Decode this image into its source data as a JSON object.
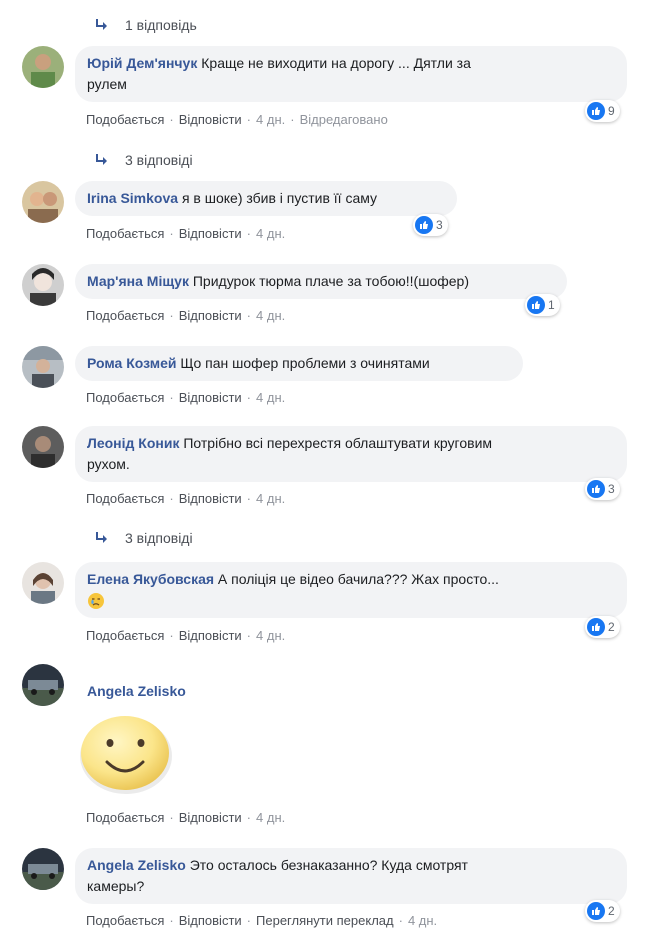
{
  "reply_links": [
    {
      "label": "1 відповідь"
    },
    {
      "label": "3 відповіді"
    },
    {
      "label": "3 відповіді"
    }
  ],
  "actions": {
    "like": "Подобається",
    "reply": "Відповісти",
    "edited": "Відредаговано",
    "translate": "Переглянути переклад"
  },
  "comments": [
    {
      "author": "Юрій Дем'янчук",
      "text": "Краще не виходити на дорогу ... Дятли за",
      "text2": "рулем",
      "time": "4 дн.",
      "reactions": "9"
    },
    {
      "author": "Irina Simkova",
      "text": "я в шоке) збив і пустив її саму",
      "time": "4 дн.",
      "reactions": "3"
    },
    {
      "author": "Мар'яна Міщук",
      "text": "Придурок тюрма плаче за тобою!!(шофер)",
      "time": "4 дн.",
      "reactions": "1"
    },
    {
      "author": "Рома Козмей",
      "text": "Що пан шофер проблеми з очинятами",
      "time": "4 дн."
    },
    {
      "author": "Леонід Коник",
      "text": "Потрібно всі перехрестя облаштувати круговим",
      "text2": "рухом.",
      "time": "4 дн.",
      "reactions": "3"
    },
    {
      "author": "Елена Якубовская",
      "text": "А поліція це відео бачила??? Жах просто...",
      "time": "4 дн.",
      "reactions": "2"
    },
    {
      "author": "Angela Zelisko",
      "time": "4 дн."
    },
    {
      "author": "Angela Zelisko",
      "text": "Это осталось безнаказанно? Куда смотрят",
      "text2": "камеры?",
      "time": "4 дн.",
      "reactions": "2"
    }
  ],
  "colors": {
    "author": "#385898",
    "bubble": "#f2f3f5",
    "like_badge": "#1877f2"
  }
}
